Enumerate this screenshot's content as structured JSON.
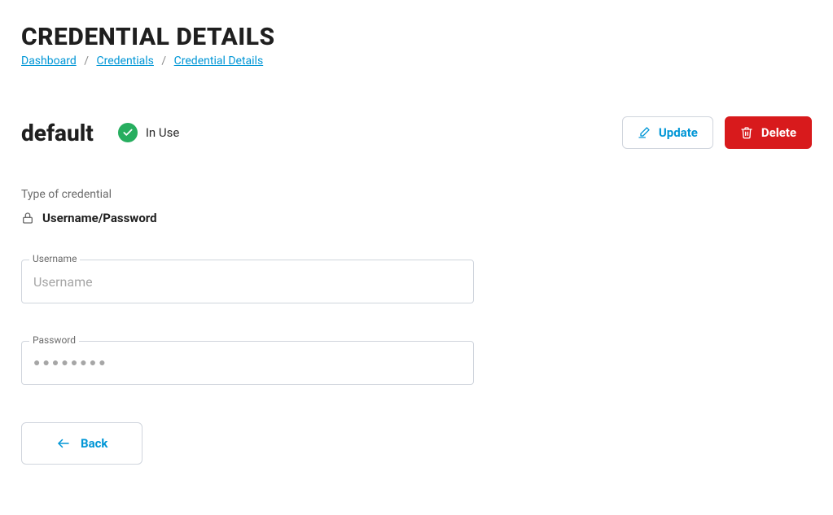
{
  "page": {
    "title": "CREDENTIAL DETAILS"
  },
  "breadcrumb": {
    "items": [
      "Dashboard",
      "Credentials",
      "Credential Details"
    ]
  },
  "credential": {
    "name": "default",
    "status_label": "In Use",
    "type_section_label": "Type of credential",
    "type_value": "Username/Password"
  },
  "actions": {
    "update": "Update",
    "delete": "Delete",
    "back": "Back"
  },
  "fields": {
    "username": {
      "label": "Username",
      "placeholder": "Username",
      "value": ""
    },
    "password": {
      "label": "Password",
      "masked": "●●●●●●●●"
    }
  }
}
